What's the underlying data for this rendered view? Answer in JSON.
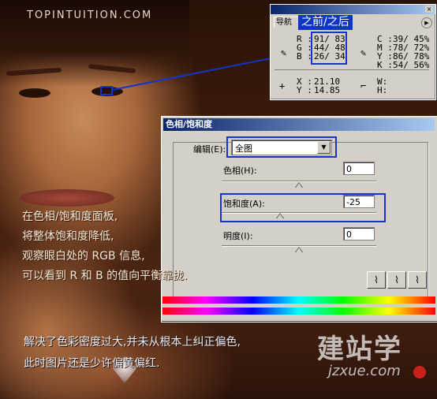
{
  "watermark_top": "TOPINTUITION.COM",
  "info_panel": {
    "tab_label": "导航",
    "callout": "之前/之后",
    "rgb": {
      "r_label": "R :",
      "r_value": "91/ 83",
      "g_label": "G :",
      "g_value": "44/ 48",
      "b_label": "B :",
      "b_value": "26/ 34"
    },
    "cmyk": {
      "c_label": "C :",
      "c_value": "39/ 45%",
      "m_label": "M :",
      "m_value": "78/ 72%",
      "y_label": "Y :",
      "y_value": "86/ 78%",
      "k_label": "K :",
      "k_value": "54/ 56%"
    },
    "position": {
      "x_label": "X :",
      "x_value": "21.10",
      "y_label": "Y :",
      "y_value": "14.85"
    },
    "size": {
      "w_label": "W:",
      "h_label": "H:"
    }
  },
  "dialog": {
    "title": "色相/饱和度",
    "edit_label": "编辑(E):",
    "edit_selected": "全图",
    "hue_label": "色相(H):",
    "hue_value": "0",
    "saturation_label": "饱和度(A):",
    "saturation_value": "-25",
    "lightness_label": "明度(I):",
    "lightness_value": "0",
    "sliders": {
      "hue_fraction": 0.5,
      "saturation_fraction": 0.375,
      "lightness_fraction": 0.5
    }
  },
  "annotation_lines": [
    "在色相/饱和度面板,",
    "将整体饱和度降低,",
    "观察眼白处的 RGB 信息,",
    "可以看到 R 和 B 的值向平衡靠拢."
  ],
  "bottom_lines": [
    "解决了色彩密度过大,并未从根本上纠正偏色,",
    "此时图片还是少许偏黄偏红."
  ],
  "logo_text": "建站学",
  "logo_url": "jzxue.com"
}
